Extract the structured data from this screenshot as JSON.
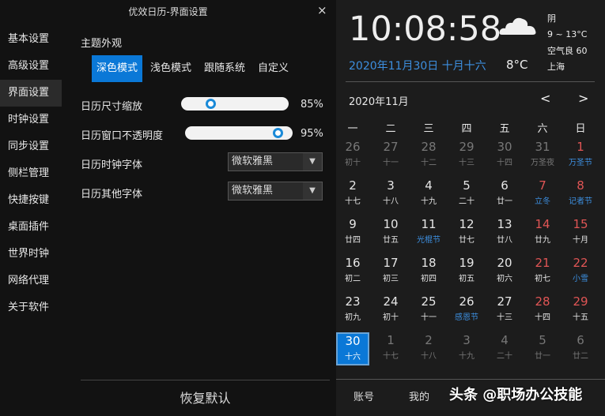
{
  "window": {
    "title": "优效日历-界面设置",
    "close": "×"
  },
  "sidebar": {
    "items": [
      "基本设置",
      "高级设置",
      "界面设置",
      "时钟设置",
      "同步设置",
      "侧栏管理",
      "快捷按键",
      "桌面插件",
      "世界时钟",
      "网络代理",
      "关于软件"
    ],
    "selected": 2
  },
  "appearance": {
    "section": "主题外观",
    "tabs": [
      "深色模式",
      "浅色模式",
      "跟随系统",
      "自定义"
    ],
    "selected": 0,
    "scale": {
      "label": "日历尺寸缩放",
      "value": "85%",
      "fraction": 0.25
    },
    "opacity": {
      "label": "日历窗口不透明度",
      "value": "95%",
      "fraction": 0.95
    },
    "clock_font": {
      "label": "日历时钟字体",
      "value": "微软雅黑"
    },
    "other_font": {
      "label": "日历其他字体",
      "value": "微软雅黑"
    },
    "reset": "恢复默认"
  },
  "clock": {
    "time": "10:08:58",
    "date": "2020年11月30日 十月十六",
    "temp": "8°C"
  },
  "weather": {
    "cond": "阴",
    "range": "9 ~ 13°C",
    "air": "空气良 60",
    "city": "上海"
  },
  "calendar": {
    "month": "2020年11月",
    "prev": "<",
    "next": ">",
    "weekdays": [
      "一",
      "二",
      "三",
      "四",
      "五",
      "六",
      "日"
    ],
    "cells": [
      [
        "26",
        "初十",
        "m"
      ],
      [
        "27",
        "十一",
        "m"
      ],
      [
        "28",
        "十二",
        "m"
      ],
      [
        "29",
        "十三",
        "m"
      ],
      [
        "30",
        "十四",
        "m"
      ],
      [
        "31",
        "万圣夜",
        "m"
      ],
      [
        "1",
        "万圣节",
        "rf"
      ],
      [
        "2",
        "十七",
        ""
      ],
      [
        "3",
        "十八",
        ""
      ],
      [
        "4",
        "十九",
        ""
      ],
      [
        "5",
        "二十",
        ""
      ],
      [
        "6",
        "廿一",
        ""
      ],
      [
        "7",
        "立冬",
        "rf"
      ],
      [
        "8",
        "记者节",
        "rf"
      ],
      [
        "9",
        "廿四",
        ""
      ],
      [
        "10",
        "廿五",
        ""
      ],
      [
        "11",
        "光棍节",
        "f"
      ],
      [
        "12",
        "廿七",
        ""
      ],
      [
        "13",
        "廿八",
        ""
      ],
      [
        "14",
        "廿九",
        "r"
      ],
      [
        "15",
        "十月",
        "r"
      ],
      [
        "16",
        "初二",
        ""
      ],
      [
        "17",
        "初三",
        ""
      ],
      [
        "18",
        "初四",
        ""
      ],
      [
        "19",
        "初五",
        ""
      ],
      [
        "20",
        "初六",
        ""
      ],
      [
        "21",
        "初七",
        "r"
      ],
      [
        "22",
        "小雪",
        "rf"
      ],
      [
        "23",
        "初九",
        ""
      ],
      [
        "24",
        "初十",
        ""
      ],
      [
        "25",
        "十一",
        ""
      ],
      [
        "26",
        "感恩节",
        "f"
      ],
      [
        "27",
        "十三",
        ""
      ],
      [
        "28",
        "十四",
        "r"
      ],
      [
        "29",
        "十五",
        "r"
      ],
      [
        "30",
        "十六",
        "s"
      ],
      [
        "1",
        "十七",
        "m"
      ],
      [
        "2",
        "十八",
        "m"
      ],
      [
        "3",
        "十九",
        "m"
      ],
      [
        "4",
        "二十",
        "m"
      ],
      [
        "5",
        "廿一",
        "m"
      ],
      [
        "6",
        "廿二",
        "m"
      ]
    ]
  },
  "bottom": {
    "account": "账号",
    "mine": "我的",
    "watermark": "头条 @职场办公技能"
  },
  "colors": {
    "accent": "#0a78d7",
    "red": "#e05555",
    "festival": "#3d8fe0",
    "muted": "#777777"
  }
}
